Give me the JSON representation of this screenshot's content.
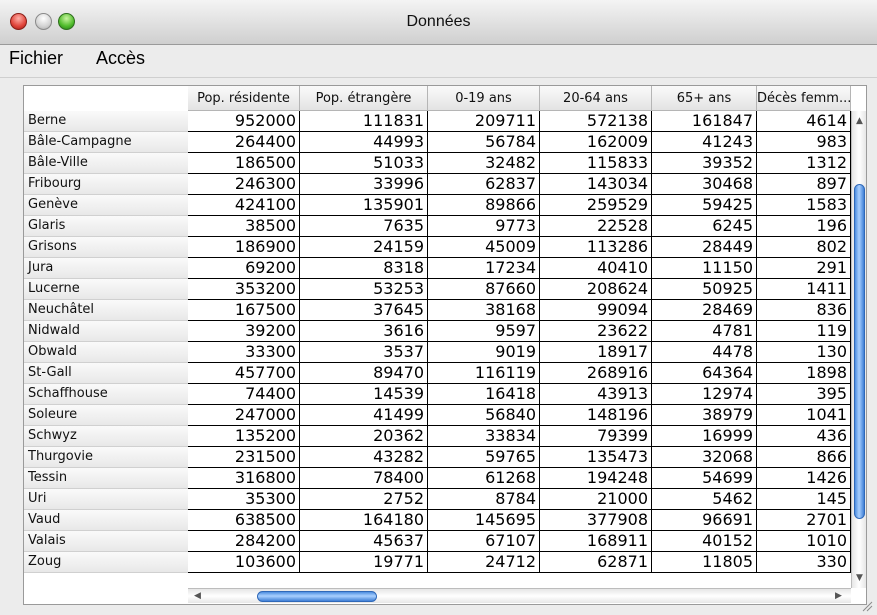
{
  "window": {
    "title": "Données"
  },
  "menu": [
    "Fichier",
    "Accès"
  ],
  "columns": [
    "Pop. résidente",
    "Pop. étrangère",
    "0-19 ans",
    "20-64 ans",
    "65+ ans",
    "Décès femm..."
  ],
  "rows": [
    {
      "name": "Berne",
      "values": [
        "952000",
        "111831",
        "209711",
        "572138",
        "161847",
        "4614"
      ]
    },
    {
      "name": "Bâle-Campagne",
      "values": [
        "264400",
        "44993",
        "56784",
        "162009",
        "41243",
        "983"
      ]
    },
    {
      "name": "Bâle-Ville",
      "values": [
        "186500",
        "51033",
        "32482",
        "115833",
        "39352",
        "1312"
      ]
    },
    {
      "name": "Fribourg",
      "values": [
        "246300",
        "33996",
        "62837",
        "143034",
        "30468",
        "897"
      ]
    },
    {
      "name": "Genève",
      "values": [
        "424100",
        "135901",
        "89866",
        "259529",
        "59425",
        "1583"
      ]
    },
    {
      "name": "Glaris",
      "values": [
        "38500",
        "7635",
        "9773",
        "22528",
        "6245",
        "196"
      ]
    },
    {
      "name": "Grisons",
      "values": [
        "186900",
        "24159",
        "45009",
        "113286",
        "28449",
        "802"
      ]
    },
    {
      "name": "Jura",
      "values": [
        "69200",
        "8318",
        "17234",
        "40410",
        "11150",
        "291"
      ]
    },
    {
      "name": "Lucerne",
      "values": [
        "353200",
        "53253",
        "87660",
        "208624",
        "50925",
        "1411"
      ]
    },
    {
      "name": "Neuchâtel",
      "values": [
        "167500",
        "37645",
        "38168",
        "99094",
        "28469",
        "836"
      ]
    },
    {
      "name": "Nidwald",
      "values": [
        "39200",
        "3616",
        "9597",
        "23622",
        "4781",
        "119"
      ]
    },
    {
      "name": "Obwald",
      "values": [
        "33300",
        "3537",
        "9019",
        "18917",
        "4478",
        "130"
      ]
    },
    {
      "name": "St-Gall",
      "values": [
        "457700",
        "89470",
        "116119",
        "268916",
        "64364",
        "1898"
      ]
    },
    {
      "name": "Schaffhouse",
      "values": [
        "74400",
        "14539",
        "16418",
        "43913",
        "12974",
        "395"
      ]
    },
    {
      "name": "Soleure",
      "values": [
        "247000",
        "41499",
        "56840",
        "148196",
        "38979",
        "1041"
      ]
    },
    {
      "name": "Schwyz",
      "values": [
        "135200",
        "20362",
        "33834",
        "79399",
        "16999",
        "436"
      ]
    },
    {
      "name": "Thurgovie",
      "values": [
        "231500",
        "43282",
        "59765",
        "135473",
        "32068",
        "866"
      ]
    },
    {
      "name": "Tessin",
      "values": [
        "316800",
        "78400",
        "61268",
        "194248",
        "54699",
        "1426"
      ]
    },
    {
      "name": "Uri",
      "values": [
        "35300",
        "2752",
        "8784",
        "21000",
        "5462",
        "145"
      ]
    },
    {
      "name": "Vaud",
      "values": [
        "638500",
        "164180",
        "145695",
        "377908",
        "96691",
        "2701"
      ]
    },
    {
      "name": "Valais",
      "values": [
        "284200",
        "45637",
        "67107",
        "168911",
        "40152",
        "1010"
      ]
    },
    {
      "name": "Zoug",
      "values": [
        "103600",
        "19771",
        "24712",
        "62871",
        "11805",
        "330"
      ]
    }
  ],
  "icons": {
    "close": "close-icon",
    "minimize": "minimize-icon",
    "zoom": "zoom-icon",
    "scroll_up": "▲",
    "scroll_down": "▼",
    "scroll_left": "◀",
    "scroll_right": "▶"
  }
}
